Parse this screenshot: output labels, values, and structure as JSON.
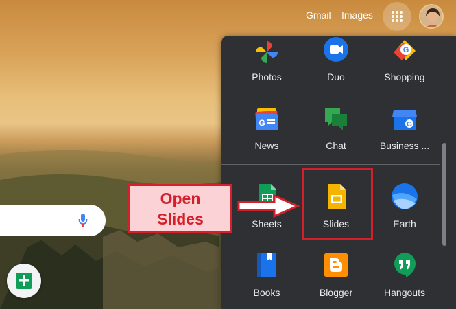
{
  "header": {
    "gmail": "Gmail",
    "images": "Images"
  },
  "apps": [
    {
      "label": "Photos",
      "icon": "photos-icon"
    },
    {
      "label": "Duo",
      "icon": "duo-icon"
    },
    {
      "label": "Shopping",
      "icon": "shopping-icon"
    },
    {
      "label": "News",
      "icon": "news-icon"
    },
    {
      "label": "Chat",
      "icon": "chat-icon"
    },
    {
      "label": "Business ...",
      "icon": "business-profile-icon"
    },
    {
      "label": "Sheets",
      "icon": "sheets-icon"
    },
    {
      "label": "Slides",
      "icon": "slides-icon"
    },
    {
      "label": "Earth",
      "icon": "earth-icon"
    },
    {
      "label": "Books",
      "icon": "books-icon"
    },
    {
      "label": "Blogger",
      "icon": "blogger-icon"
    },
    {
      "label": "Hangouts",
      "icon": "hangouts-icon"
    }
  ],
  "annotation": {
    "line1": "Open",
    "line2": "Slides"
  },
  "colors": {
    "panel": "#2f3034",
    "annotation_red": "#d51f2a",
    "annotation_fill": "#fbd3d6"
  }
}
